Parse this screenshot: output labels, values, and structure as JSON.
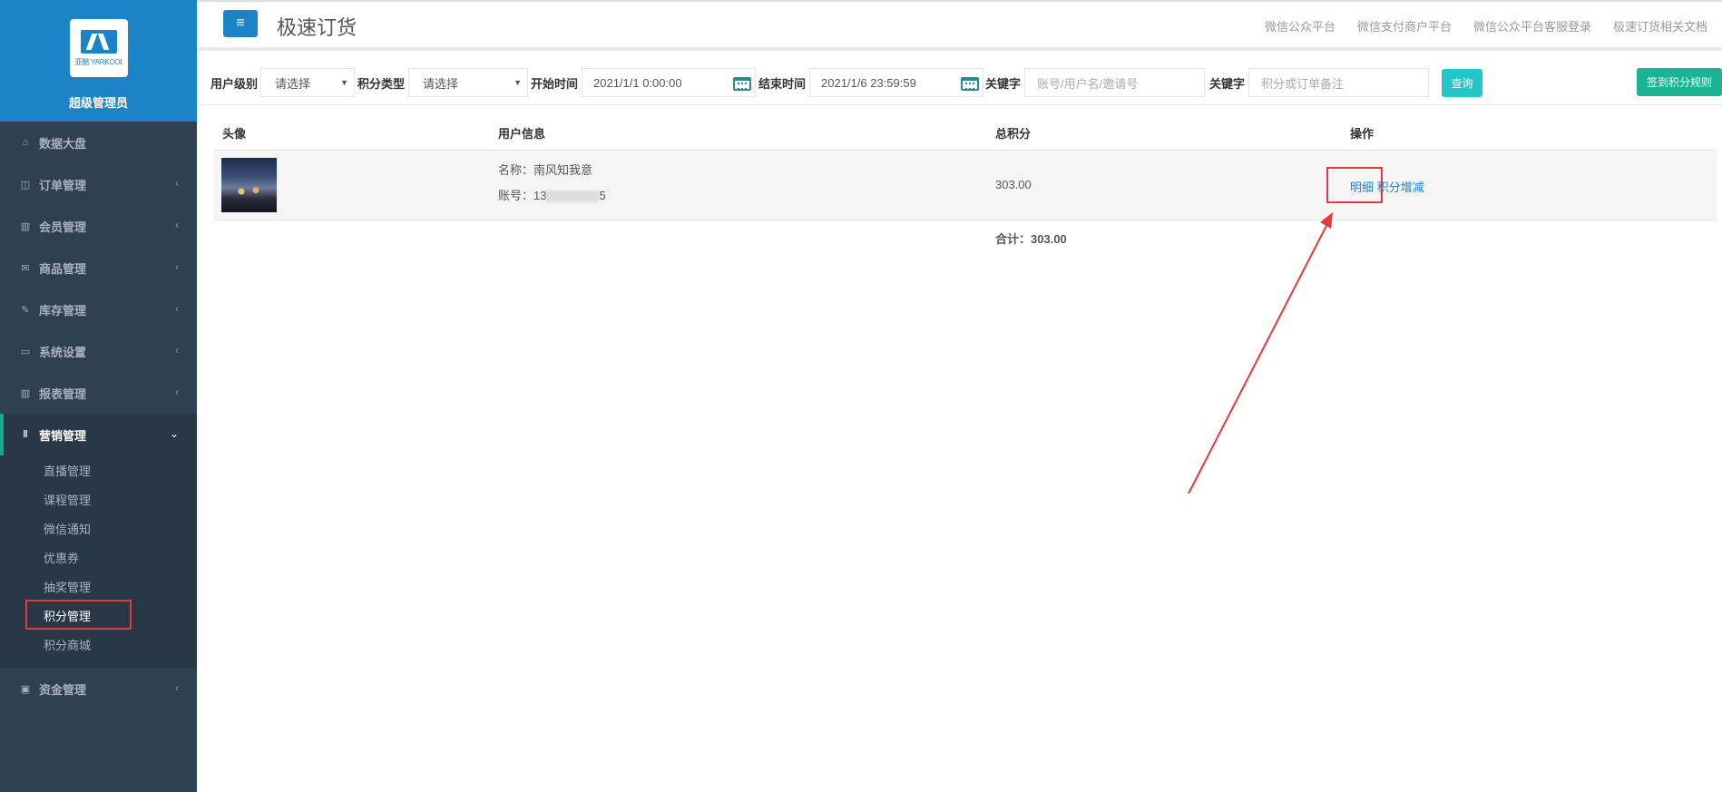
{
  "sidebar": {
    "logo_text": "亚酷 YARKOOI",
    "user_role": "超级管理员",
    "items": [
      {
        "label": "数据大盘",
        "icon": "home-icon"
      },
      {
        "label": "订单管理",
        "icon": "columns-icon"
      },
      {
        "label": "会员管理",
        "icon": "bar-chart-icon"
      },
      {
        "label": "商品管理",
        "icon": "envelope-icon"
      },
      {
        "label": "库存管理",
        "icon": "edit-icon"
      },
      {
        "label": "系统设置",
        "icon": "desktop-icon"
      },
      {
        "label": "报表管理",
        "icon": "bar-chart-icon"
      },
      {
        "label": "营销管理",
        "icon": "cutlery-icon"
      },
      {
        "label": "资金管理",
        "icon": "money-icon"
      }
    ],
    "marketing_sub": [
      "直播管理",
      "课程管理",
      "微信通知",
      "优惠券",
      "抽奖管理",
      "积分管理",
      "积分商城"
    ],
    "active_sub": "积分管理"
  },
  "topbar": {
    "title": "极速订货",
    "links": [
      "微信公众平台",
      "微信支付商户平台",
      "微信公众平台客服登录",
      "极速订货相关文档"
    ]
  },
  "filters": {
    "user_level_label": "用户级别",
    "user_level_value": "请选择",
    "points_type_label": "积分类型",
    "points_type_value": "请选择",
    "start_label": "开始时间",
    "start_value": "2021/1/1 0:00:00",
    "end_label": "结束时间",
    "end_value": "2021/1/6 23:59:59",
    "keyword1_label": "关键字",
    "keyword1_placeholder": "账号/用户名/邀请号",
    "keyword2_label": "关键字",
    "keyword2_placeholder": "积分或订单备注",
    "query_button": "查询",
    "rules_button": "签到积分规则"
  },
  "table": {
    "headers": [
      "头像",
      "用户信息",
      "总积分",
      "操作"
    ],
    "rows": [
      {
        "name_label": "名称：",
        "name": "南风知我意",
        "account_label": "账号：",
        "account_prefix": "13",
        "account_suffix": "5",
        "points": "303.00",
        "action_detail": "明细",
        "action_adjust": "积分增减"
      }
    ],
    "total_label": "合计：",
    "total_value": "303.00"
  },
  "colors": {
    "sidebar_bg": "#2f4050",
    "profile_bg": "#1c84c6",
    "annotation_red": "#e8383d",
    "query_btn": "#23c6c8",
    "rules_btn": "#1ab394"
  }
}
